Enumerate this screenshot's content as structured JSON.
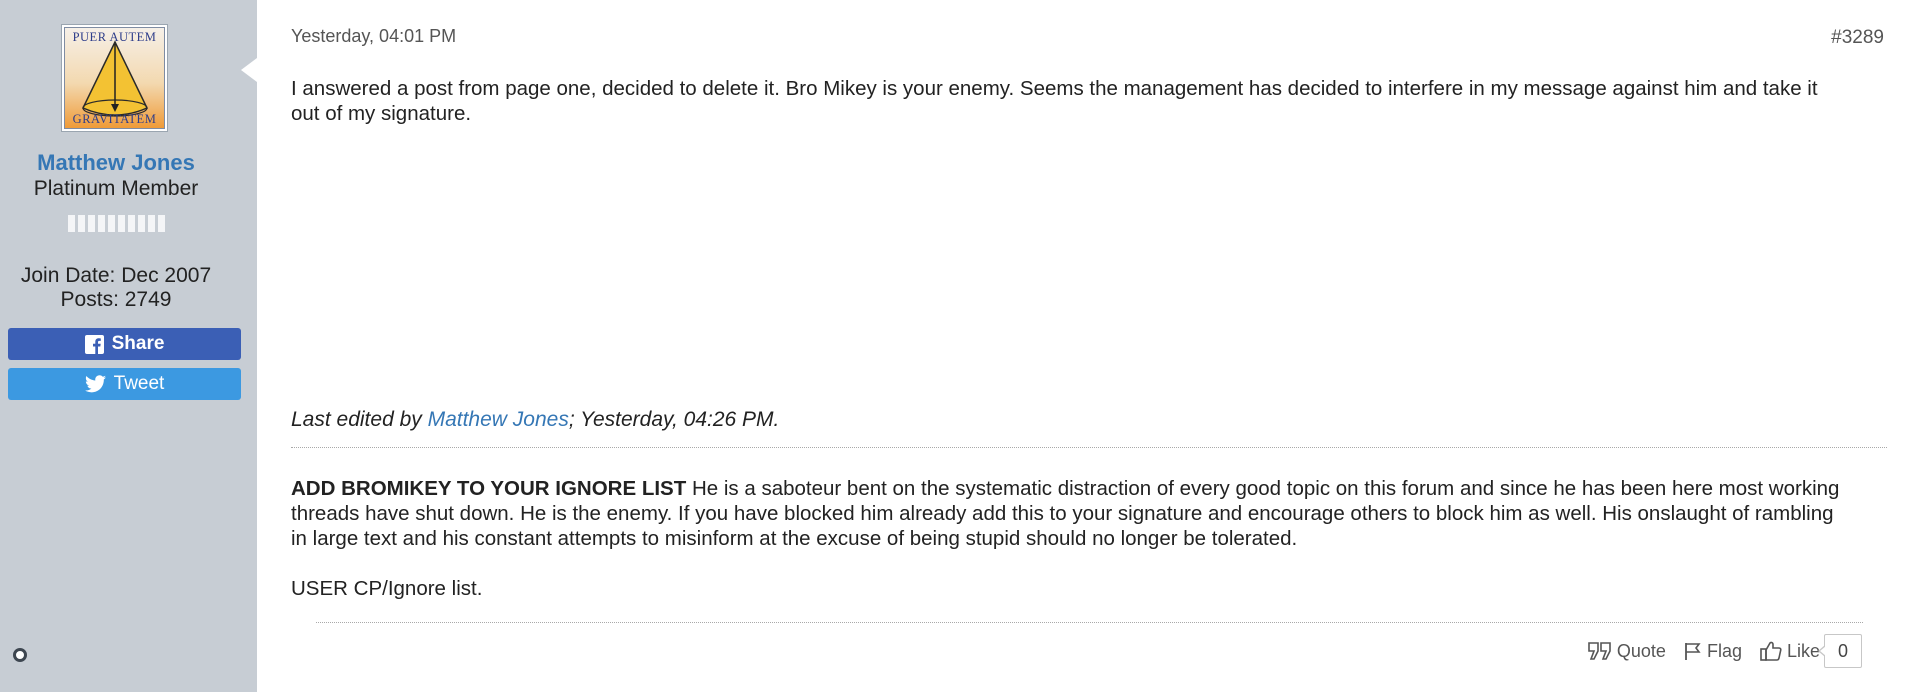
{
  "user": {
    "name": "Matthew Jones",
    "title": "Platinum Member",
    "avatar_text_top": "PUER AUTEM",
    "avatar_text_bottom": "GRAVITATEM",
    "join_date": "Join Date: Dec 2007",
    "posts": "Posts: 2749",
    "rank_segments": 10,
    "share_label": "Share",
    "tweet_label": "Tweet",
    "online_status_icon": "status-dot-icon"
  },
  "post": {
    "date": "Yesterday, 04:01 PM",
    "number": "#3289",
    "content": "I answered a post from page one, decided to delete it. Bro Mikey is your enemy. Seems the management has decided to interfere in my message against him and take it out of my signature.",
    "edited_prefix": "Last edited by ",
    "edited_by": "Matthew Jones",
    "edited_suffix": "; Yesterday, 04:26 PM."
  },
  "signature": {
    "bold_lead": "ADD BROMIKEY TO YOUR IGNORE LIST",
    "text": " He is a saboteur bent on the systematic distraction of every good topic on this forum and since he has been here most working threads have shut down. He is the enemy. If you have blocked him already add this to your signature and encourage others to block him as well. His onslaught of rambling in large text and his constant attempts to misinform at the excuse of being stupid should no longer be tolerated.",
    "line2": "USER CP/Ignore list."
  },
  "actions": {
    "quote": "Quote",
    "flag": "Flag",
    "like": "Like",
    "like_count": "0"
  },
  "colors": {
    "sidebar_bg": "#c7cdd4",
    "username": "#3577b5",
    "facebook": "#3b5fb5",
    "twitter": "#3c99e1"
  }
}
